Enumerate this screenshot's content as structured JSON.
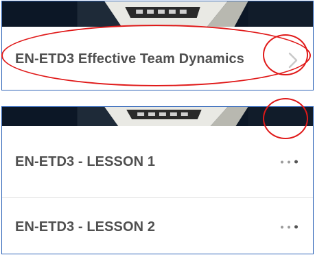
{
  "course": {
    "title": "EN-ETD3 Effective Team Dynamics"
  },
  "lessons": [
    {
      "title": "EN-ETD3 - LESSON 1"
    },
    {
      "title": "EN-ETD3 - LESSON 2"
    }
  ],
  "icons": {
    "course_row": "chevron-right-icon",
    "lesson_menu": "more-horizontal-icon"
  },
  "colors": {
    "panel_border": "#2f64b8",
    "highlight": "#e01919",
    "title_text": "#505050",
    "banner_dark": "#0c1726"
  }
}
